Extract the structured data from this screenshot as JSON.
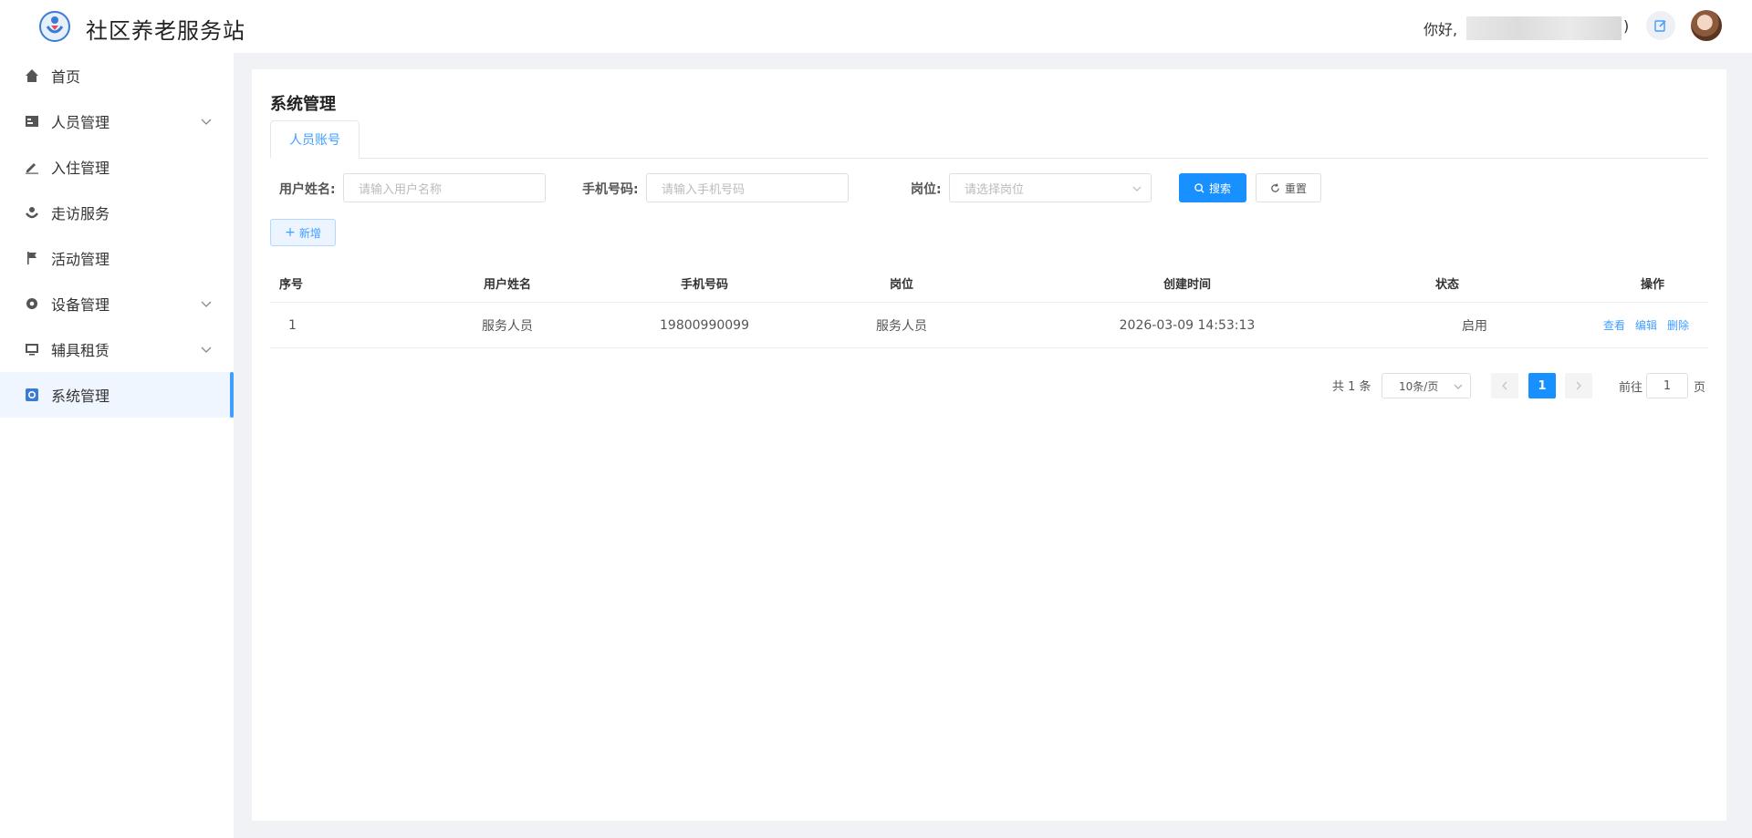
{
  "header": {
    "title": "社区养老服务站",
    "greeting": "你好,",
    "paren": ")"
  },
  "sidebar": {
    "items": [
      {
        "label": "首页",
        "icon": "home-icon"
      },
      {
        "label": "人员管理",
        "icon": "staff-icon",
        "expandable": true
      },
      {
        "label": "入住管理",
        "icon": "pen-icon"
      },
      {
        "label": "走访服务",
        "icon": "visit-icon"
      },
      {
        "label": "活动管理",
        "icon": "flag-icon"
      },
      {
        "label": "设备管理",
        "icon": "gear-icon",
        "expandable": true
      },
      {
        "label": "辅具租赁",
        "icon": "monitor-icon",
        "expandable": true
      },
      {
        "label": "系统管理",
        "icon": "settings-icon",
        "active": true
      }
    ]
  },
  "page": {
    "title": "系统管理",
    "tab": "人员账号"
  },
  "filters": {
    "name_label": "用户姓名:",
    "name_placeholder": "请输入用户名称",
    "phone_label": "手机号码:",
    "phone_placeholder": "请输入手机号码",
    "post_label": "岗位:",
    "post_placeholder": "请选择岗位",
    "search_label": "搜索",
    "reset_label": "重置",
    "add_label": "新增"
  },
  "table": {
    "columns": [
      "序号",
      "用户姓名",
      "手机号码",
      "岗位",
      "创建时间",
      "状态",
      "操作"
    ],
    "rows": [
      {
        "index": "1",
        "name": "服务人员",
        "phone": "19800990099",
        "post": "服务人员",
        "created": "2026-03-09 14:53:13",
        "status": "启用"
      }
    ],
    "actions": {
      "view": "查看",
      "edit": "编辑",
      "delete": "删除"
    }
  },
  "pagination": {
    "total": "共 1 条",
    "page_size": "10条/页",
    "current": "1",
    "goto_label": "前往",
    "goto_value": "1",
    "page_suffix": "页"
  },
  "colors": {
    "primary": "#1890ff",
    "link": "#409eff"
  }
}
